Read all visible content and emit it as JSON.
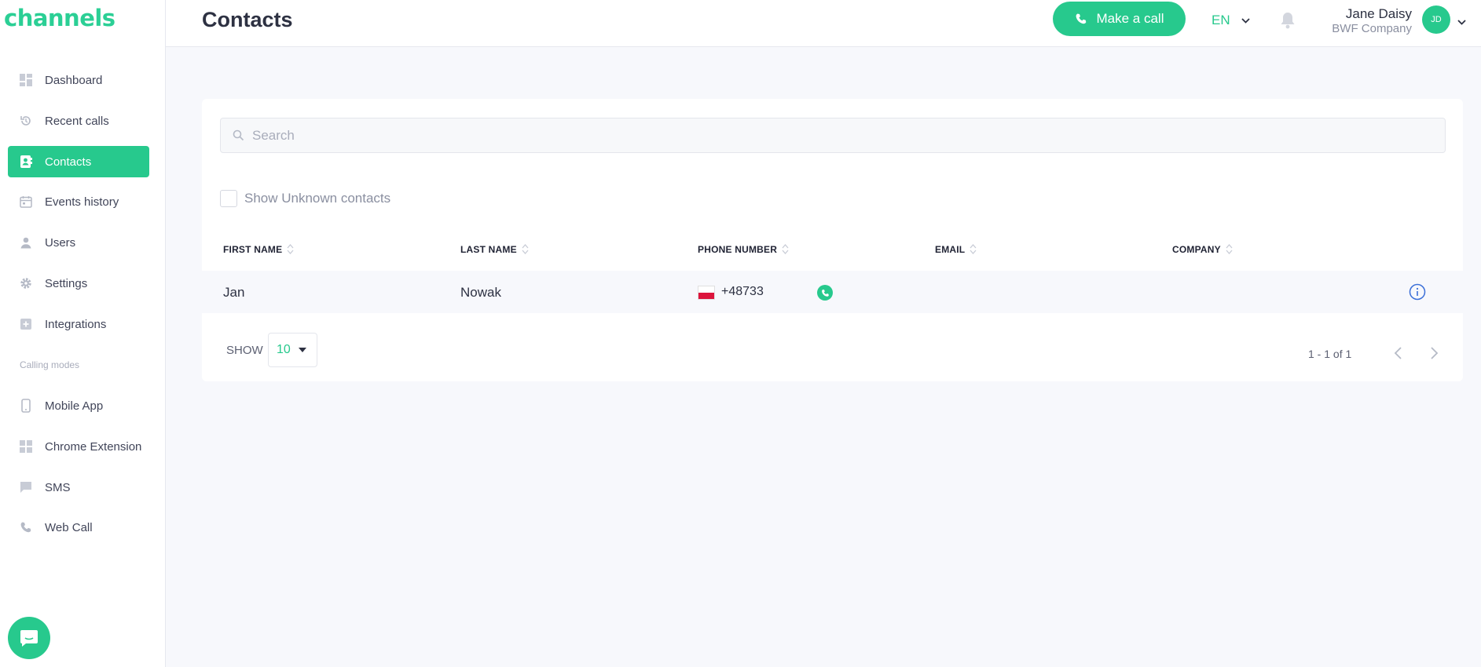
{
  "app": {
    "logo": "channels"
  },
  "sidebar": {
    "items": [
      {
        "label": "Dashboard",
        "icon": "dashboard-icon"
      },
      {
        "label": "Recent calls",
        "icon": "history-icon"
      },
      {
        "label": "Contacts",
        "icon": "contacts-icon",
        "active": true
      },
      {
        "label": "Events history",
        "icon": "calendar-icon"
      },
      {
        "label": "Users",
        "icon": "user-icon"
      },
      {
        "label": "Settings",
        "icon": "gear-icon"
      },
      {
        "label": "Integrations",
        "icon": "plus-box-icon"
      }
    ],
    "section_label": "Calling modes",
    "modes": [
      {
        "label": "Mobile App",
        "icon": "mobile-icon"
      },
      {
        "label": "Chrome Extension",
        "icon": "extension-icon"
      },
      {
        "label": "SMS",
        "icon": "chat-icon"
      },
      {
        "label": "Web Call",
        "icon": "phone-icon"
      }
    ]
  },
  "header": {
    "title": "Contacts",
    "call_button": "Make a call",
    "language": "EN",
    "user": {
      "name": "Jane Daisy",
      "company": "BWF Company",
      "initials": "JD"
    }
  },
  "contacts": {
    "search_placeholder": "Search",
    "show_unknown_label": "Show Unknown contacts",
    "columns": [
      "FIRST NAME",
      "LAST NAME",
      "PHONE NUMBER",
      "EMAIL",
      "COMPANY"
    ],
    "rows": [
      {
        "first_name": "Jan",
        "last_name": "Nowak",
        "phone": "+48733",
        "email": "",
        "company": ""
      }
    ],
    "show_label": "SHOW",
    "page_size": "10",
    "pagination": "1 - 1 of 1"
  },
  "colors": {
    "accent": "#27c98d",
    "info": "#3b6fd8"
  }
}
